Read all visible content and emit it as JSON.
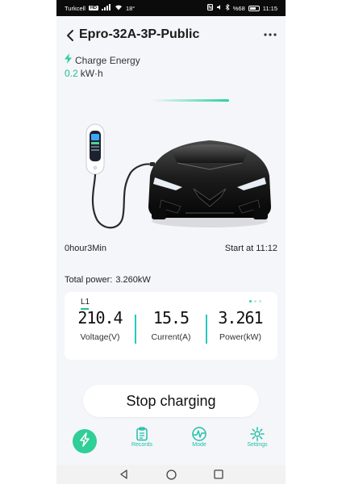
{
  "status_bar": {
    "carrier": "Turkcell",
    "network_badge": "HD",
    "signal": "4G",
    "temperature": "18°",
    "battery": "%68",
    "battery_level": 0.68,
    "time": "11:15"
  },
  "header": {
    "title": "Epro-32A-3P-Public"
  },
  "charge_energy": {
    "label": "Charge Energy",
    "value": "0.2",
    "unit": "kW·h"
  },
  "session": {
    "duration": "0hour3Min",
    "start_time": "Start at 11:12",
    "total_power_label": "Total power:",
    "total_power_value": "3.260kW"
  },
  "stats": {
    "phase": "L1",
    "voltage_value": "210.4",
    "voltage_label": "Voltage(V)",
    "current_value": "15.5",
    "current_label": "Current(A)",
    "power_value": "3.261",
    "power_label": "Power(kW)"
  },
  "stop_button_label": "Stop charging",
  "bottom_nav": {
    "records_label": "Records",
    "mode_label": "Mode",
    "settings_label": "Settings"
  },
  "colors": {
    "accent": "#2fcf97",
    "nav_text": "#1fbfa7",
    "card_divider": "#29c7c0"
  },
  "icons": [
    "back-arrow-icon",
    "more-icon",
    "bolt-icon",
    "charge-nav-icon",
    "records-icon",
    "mode-icon",
    "settings-icon",
    "android-back-icon",
    "android-home-icon",
    "android-recents-icon"
  ]
}
